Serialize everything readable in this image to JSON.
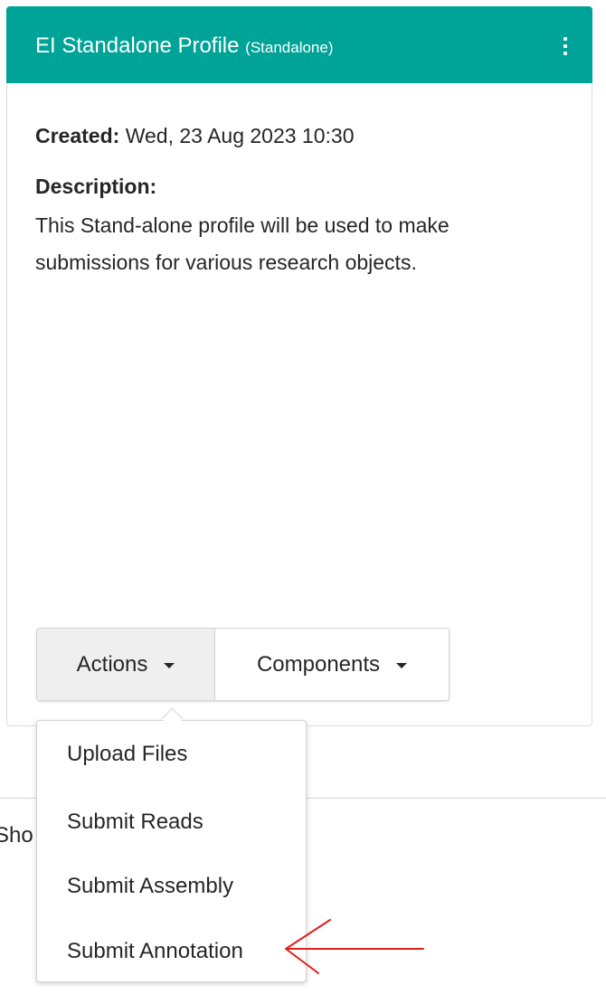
{
  "card": {
    "title": "EI Standalone Profile",
    "title_sub": "(Standalone)",
    "header_color": "#00a397",
    "menu_icon": "kebab-menu-icon",
    "created_label": "Created:",
    "created_value": "Wed, 23 Aug 2023 10:30",
    "description_label": "Description:",
    "description_text": "This Stand-alone profile will be used to make submissions for various research objects."
  },
  "buttons": {
    "actions_label": "Actions",
    "components_label": "Components"
  },
  "background": {
    "partial_text": "Sho"
  },
  "actions_menu": {
    "items": [
      {
        "label": "Upload Files"
      },
      {
        "label": "Submit Reads"
      },
      {
        "label": "Submit Assembly"
      },
      {
        "label": "Submit Annotation"
      }
    ]
  },
  "annotation": {
    "arrow_color": "#e0201c",
    "arrow_icon": "left-arrow-icon"
  }
}
